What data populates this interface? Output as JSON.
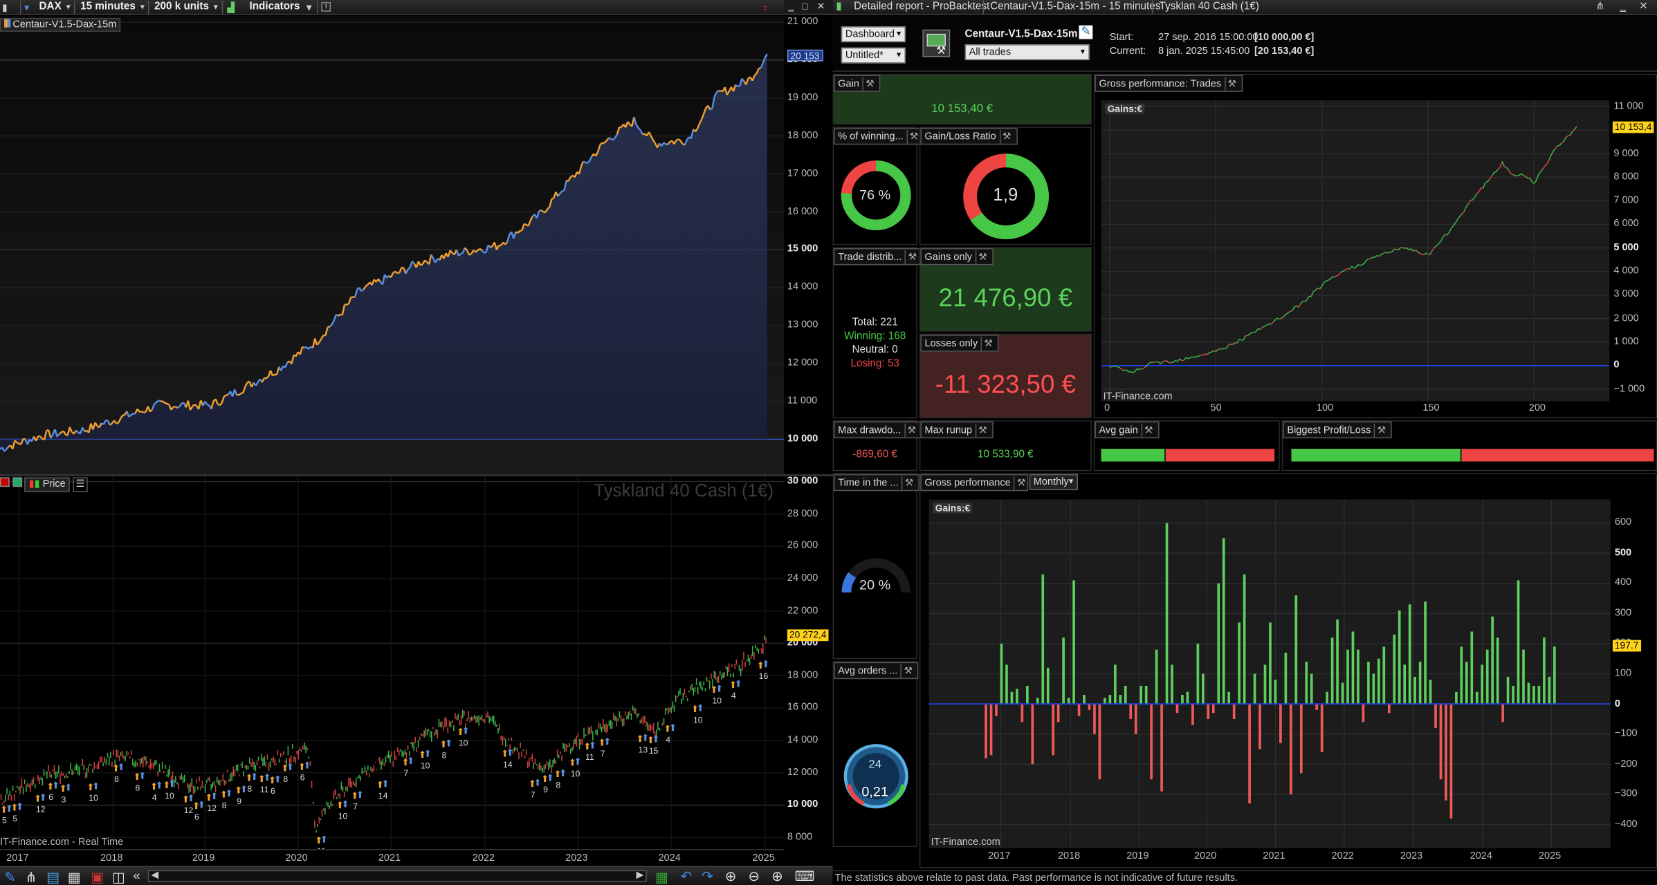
{
  "toolbar": {
    "symbol": "DAX",
    "interval": "15 minutes",
    "units": "200 k units",
    "indicators": "Indicators",
    "info": "i"
  },
  "equity_chart": {
    "label": "Centaur-V1.5-Dax-15m",
    "last_badge": "20 153",
    "y_ticks": [
      {
        "v": 21000,
        "t": "21 000",
        "b": false
      },
      {
        "v": 20000,
        "t": "20 000",
        "b": true
      },
      {
        "v": 19000,
        "t": "19 000",
        "b": false
      },
      {
        "v": 18000,
        "t": "18 000",
        "b": false
      },
      {
        "v": 17000,
        "t": "17 000",
        "b": false
      },
      {
        "v": 16000,
        "t": "16 000",
        "b": false
      },
      {
        "v": 15000,
        "t": "15 000",
        "b": true
      },
      {
        "v": 14000,
        "t": "14 000",
        "b": false
      },
      {
        "v": 13000,
        "t": "13 000",
        "b": false
      },
      {
        "v": 12000,
        "t": "12 000",
        "b": false
      },
      {
        "v": 11000,
        "t": "11 000",
        "b": false
      },
      {
        "v": 10000,
        "t": "10 000",
        "b": true
      }
    ]
  },
  "price_chart": {
    "watermark": "Tyskland 40 Cash (1€)",
    "price_label": "Price",
    "last_badge": "20 272,4",
    "footer": "IT-Finance.com - Real Time",
    "y_ticks": [
      {
        "v": 30000,
        "t": "30 000",
        "b": true
      },
      {
        "v": 28000,
        "t": "28 000",
        "b": false
      },
      {
        "v": 26000,
        "t": "26 000",
        "b": false
      },
      {
        "v": 24000,
        "t": "24 000",
        "b": false
      },
      {
        "v": 22000,
        "t": "22 000",
        "b": false
      },
      {
        "v": 20000,
        "t": "20 000",
        "b": true
      },
      {
        "v": 18000,
        "t": "18 000",
        "b": false
      },
      {
        "v": 16000,
        "t": "16 000",
        "b": false
      },
      {
        "v": 14000,
        "t": "14 000",
        "b": false
      },
      {
        "v": 12000,
        "t": "12 000",
        "b": false
      },
      {
        "v": 10000,
        "t": "10 000",
        "b": true
      },
      {
        "v": 8000,
        "t": "8 000",
        "b": false
      }
    ],
    "x_ticks": [
      "2017",
      "2018",
      "2019",
      "2020",
      "2021",
      "2022",
      "2023",
      "2024",
      "2025"
    ],
    "trade_labels": [
      "5",
      "5",
      "12",
      "6",
      "3",
      "10",
      "8",
      "8",
      "4",
      "10",
      "12",
      "6",
      "12",
      "8",
      "9",
      "8",
      "11",
      "6",
      "8",
      "6",
      "11",
      "10",
      "7",
      "14",
      "7",
      "10",
      "8",
      "10",
      "14",
      "7",
      "9",
      "8",
      "10",
      "11",
      "7",
      "13",
      "15",
      "4",
      "10",
      "10",
      "4",
      "16"
    ]
  },
  "report": {
    "title": "Detailed report - ProBacktest",
    "strategy_tab": "Centaur-V1.5-Dax-15m - 15 minutes",
    "instrument_tab": "Tysklan 40 Cash (1€)",
    "view_select": "Dashboard",
    "layout_select": "Untitled*",
    "strategy_name": "Centaur-V1.5-Dax-15m",
    "filter_select": "All trades",
    "start_label": "Start:",
    "start_date": "27 sep. 2016 15:00:00",
    "start_value": "[10 000,00 €]",
    "current_label": "Current:",
    "current_date": "8 jan. 2025 15:45:00",
    "current_value": "[20 153,40 €]",
    "footer": "The statistics above relate to past data. Past performance is not indicative of future results."
  },
  "panels": {
    "gain": {
      "title": "Gain",
      "value": "10 153,40 €"
    },
    "winning": {
      "title": "% of winning...",
      "value": "76 %",
      "fraction": 0.76
    },
    "gain_loss": {
      "title": "Gain/Loss Ratio",
      "value": "1,9",
      "fraction": 0.655
    },
    "trade_dist": {
      "title": "Trade distrib...",
      "total": "Total: 221",
      "winning": "Winning: 168",
      "neutral": "Neutral: 0",
      "losing": "Losing: 53"
    },
    "gains_only": {
      "title": "Gains only",
      "value": "21 476,90 €"
    },
    "losses_only": {
      "title": "Losses only",
      "value": "-11 323,50 €"
    },
    "max_drawdown": {
      "title": "Max drawdo...",
      "value": "-869,60 €"
    },
    "max_runup": {
      "title": "Max runup",
      "value": "10 533,90 €"
    },
    "avg_gain": {
      "title": "Avg gain",
      "win_fraction": 0.37
    },
    "biggest": {
      "title": "Biggest Profit/Loss",
      "win_fraction": 0.47
    },
    "time_in_market": {
      "title": "Time in the ...",
      "value": "20 %",
      "fraction": 0.2
    },
    "avg_orders": {
      "title": "Avg orders ...",
      "value": "0,21",
      "dial": "24"
    },
    "gross_trades": {
      "title": "Gross performance: Trades",
      "label": "Gains:€",
      "badge": "10 153,4",
      "footer": "IT-Finance.com"
    },
    "gross_monthly": {
      "title": "Gross performance",
      "period": "Monthly",
      "label": "Gains:€",
      "badge": "197.7",
      "footer": "IT-Finance.com"
    }
  },
  "colors": {
    "gain_green": "#46c846",
    "loss_red": "#ee4444",
    "equity_orange": "#f0a030",
    "equity_blue": "#5a90e0",
    "badge_yellow": "#ffd21e"
  },
  "chart_data": [
    {
      "type": "line",
      "title": "Gross performance: Trades",
      "ylabel": "Gains:€",
      "x": [
        0,
        10,
        20,
        30,
        40,
        50,
        60,
        70,
        80,
        90,
        100,
        110,
        120,
        130,
        140,
        150,
        160,
        170,
        180,
        185,
        190,
        195,
        200,
        210,
        220
      ],
      "values": [
        0,
        -300,
        100,
        200,
        400,
        600,
        1000,
        1500,
        2000,
        2600,
        3400,
        4000,
        4400,
        4800,
        5000,
        4700,
        5700,
        7000,
        8000,
        8600,
        8100,
        8100,
        7800,
        9200,
        10153
      ],
      "ylim": [
        -1200,
        11000
      ],
      "xlim": [
        0,
        230
      ],
      "yticks": [
        11000,
        10000,
        9000,
        8000,
        7000,
        6000,
        5000,
        4000,
        3000,
        2000,
        1000,
        0,
        -1000
      ],
      "xticks": [
        0,
        50,
        100,
        150,
        200
      ]
    },
    {
      "type": "bar",
      "title": "Gross performance",
      "ylabel": "Gains:€",
      "period": "Monthly",
      "xticks": [
        "2017",
        "2018",
        "2019",
        "2020",
        "2021",
        "2022",
        "2023",
        "2024",
        "2025"
      ],
      "values": [
        -180,
        -170,
        -40,
        200,
        130,
        40,
        50,
        -60,
        60,
        -200,
        20,
        430,
        120,
        -170,
        -60,
        220,
        20,
        410,
        -40,
        30,
        -20,
        -100,
        -250,
        20,
        30,
        130,
        30,
        60,
        -50,
        -100,
        60,
        60,
        -250,
        180,
        -290,
        600,
        130,
        -30,
        30,
        40,
        -70,
        200,
        100,
        -50,
        -30,
        400,
        550,
        40,
        -50,
        270,
        430,
        -330,
        100,
        -150,
        130,
        270,
        80,
        -130,
        170,
        -300,
        360,
        -230,
        140,
        100,
        -20,
        -160,
        40,
        220,
        280,
        70,
        180,
        240,
        180,
        -60,
        140,
        100,
        150,
        190,
        -30,
        230,
        310,
        130,
        330,
        90,
        140,
        340,
        80,
        -80,
        -250,
        -320,
        -380,
        40,
        190,
        140,
        240,
        40,
        130,
        180,
        290,
        220,
        -60,
        90,
        60,
        410,
        180,
        70,
        60,
        60,
        220,
        90,
        190
      ],
      "ylim": [
        -450,
        650
      ],
      "yticks": [
        600,
        500,
        400,
        300,
        200,
        100,
        0,
        -100,
        -200,
        -300,
        -400
      ]
    }
  ]
}
